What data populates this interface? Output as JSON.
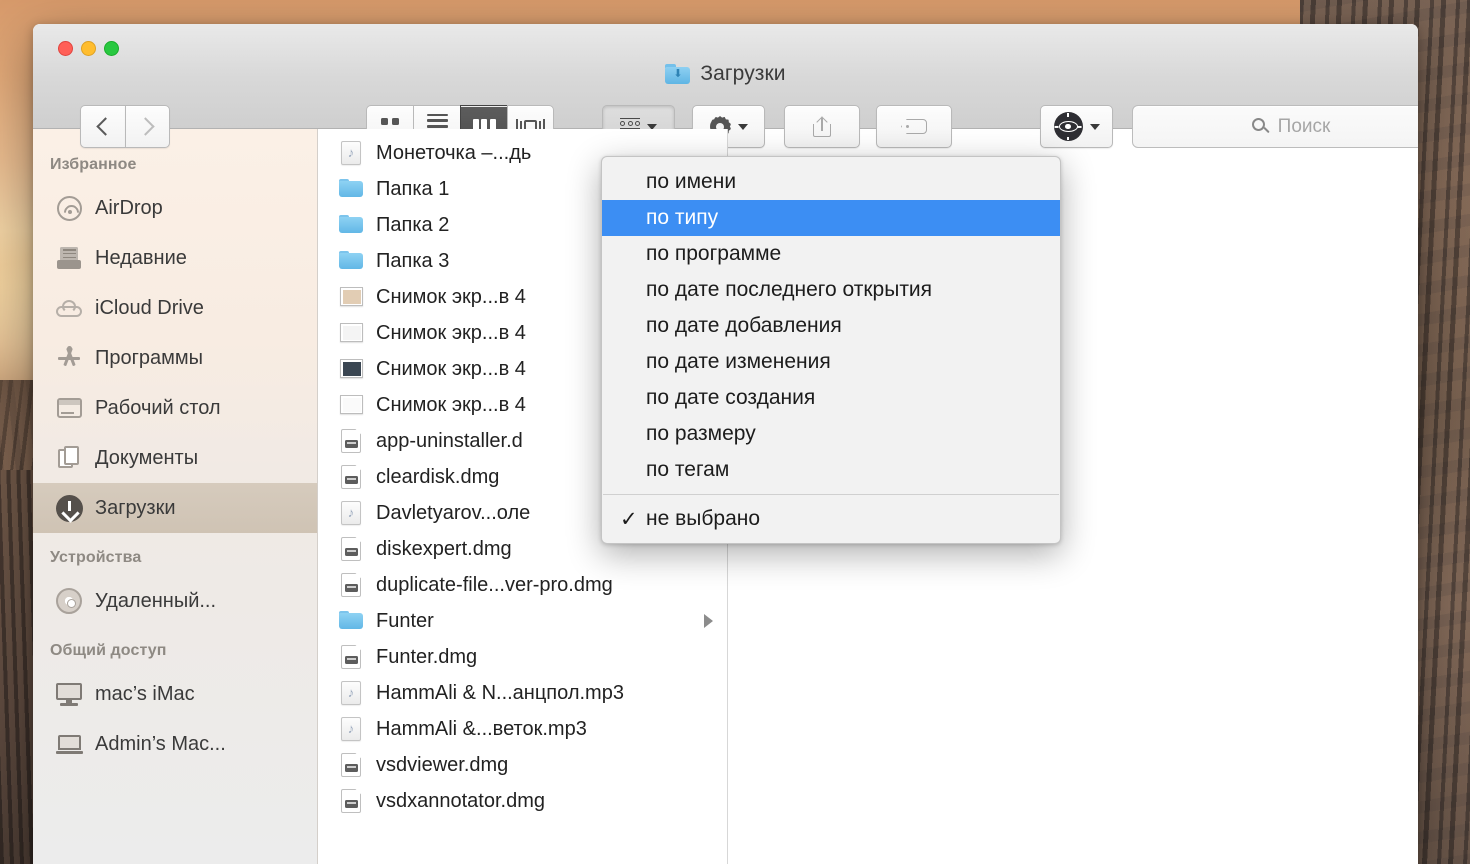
{
  "window": {
    "title": "Загрузки",
    "title_icon": "downloads-folder-icon",
    "traffic_lights": {
      "close": "#ff5f57",
      "minimize": "#ffbd2e",
      "zoom": "#28c840"
    }
  },
  "toolbar": {
    "back_icon": "chevron-left-icon",
    "forward_icon": "chevron-right-icon",
    "view_modes": [
      {
        "name": "icon-view",
        "icon": "grid-icon",
        "active": false
      },
      {
        "name": "list-view",
        "icon": "list-icon",
        "active": false
      },
      {
        "name": "column-view",
        "icon": "columns-icon",
        "active": true
      },
      {
        "name": "coverflow-view",
        "icon": "coverflow-icon",
        "active": false
      }
    ],
    "arrange_icon": "arrange-grid-icon",
    "gear_icon": "gear-icon",
    "share_icon": "share-icon",
    "tag_icon": "tag-icon",
    "eye_icon": "eye-app-icon",
    "caret_icon": "chevron-down-icon"
  },
  "search": {
    "placeholder": "Поиск",
    "value": "",
    "icon": "search-icon"
  },
  "sidebar": {
    "sections": [
      {
        "header": "Избранное",
        "items": [
          {
            "label": "AirDrop",
            "icon": "airdrop-icon",
            "selected": false
          },
          {
            "label": "Недавние",
            "icon": "recents-icon",
            "selected": false
          },
          {
            "label": "iCloud Drive",
            "icon": "cloud-icon",
            "selected": false
          },
          {
            "label": "Программы",
            "icon": "apps-icon",
            "selected": false
          },
          {
            "label": "Рабочий стол",
            "icon": "desktop-icon",
            "selected": false
          },
          {
            "label": "Документы",
            "icon": "documents-icon",
            "selected": false
          },
          {
            "label": "Загрузки",
            "icon": "downloads-icon",
            "selected": true
          }
        ]
      },
      {
        "header": "Устройства",
        "items": [
          {
            "label": "Удаленный...",
            "icon": "disc-icon",
            "selected": false
          }
        ]
      },
      {
        "header": "Общий доступ",
        "items": [
          {
            "label": "mac’s iMac",
            "icon": "imac-icon",
            "selected": false
          },
          {
            "label": "Admin’s Mac...",
            "icon": "laptop-icon",
            "selected": false
          }
        ]
      }
    ]
  },
  "file_list": [
    {
      "name": "Монеточка –...дь",
      "kind": "mp3",
      "disclosure": false
    },
    {
      "name": "Папка 1",
      "kind": "folder",
      "disclosure": false
    },
    {
      "name": "Папка 2",
      "kind": "folder",
      "disclosure": false
    },
    {
      "name": "Папка 3",
      "kind": "folder",
      "disclosure": false
    },
    {
      "name": "Снимок экр...в 4",
      "kind": "screenshot",
      "thumb": "#e2cdb4",
      "disclosure": false
    },
    {
      "name": "Снимок экр...в 4",
      "kind": "screenshot",
      "thumb": "#f4f4f4",
      "disclosure": false
    },
    {
      "name": "Снимок экр...в 4",
      "kind": "screenshot",
      "thumb": "#3a4652",
      "disclosure": false
    },
    {
      "name": "Снимок экр...в 4",
      "kind": "screenshot",
      "thumb": "#fafafa",
      "disclosure": false
    },
    {
      "name": "app-uninstaller.d",
      "kind": "dmg",
      "disclosure": false
    },
    {
      "name": "cleardisk.dmg",
      "kind": "dmg",
      "disclosure": false
    },
    {
      "name": "Davletyarov...оле",
      "kind": "mp3",
      "disclosure": false
    },
    {
      "name": "diskexpert.dmg",
      "kind": "dmg",
      "disclosure": false
    },
    {
      "name": "duplicate-file...ver-pro.dmg",
      "kind": "dmg",
      "disclosure": false
    },
    {
      "name": "Funter",
      "kind": "folder",
      "disclosure": true
    },
    {
      "name": "Funter.dmg",
      "kind": "dmg",
      "disclosure": false
    },
    {
      "name": "HammAli & N...анцпол.mp3",
      "kind": "mp3",
      "disclosure": false
    },
    {
      "name": "HammAli &...веток.mp3",
      "kind": "mp3",
      "disclosure": false
    },
    {
      "name": "vsdviewer.dmg",
      "kind": "dmg",
      "disclosure": false
    },
    {
      "name": "vsdxannotator.dmg",
      "kind": "dmg",
      "disclosure": false
    }
  ],
  "arrange_menu": {
    "items": [
      {
        "label": "по имени",
        "highlighted": false,
        "checked": false
      },
      {
        "label": "по типу",
        "highlighted": true,
        "checked": false
      },
      {
        "label": "по программе",
        "highlighted": false,
        "checked": false
      },
      {
        "label": "по дате последнего открытия",
        "highlighted": false,
        "checked": false
      },
      {
        "label": "по дате добавления",
        "highlighted": false,
        "checked": false
      },
      {
        "label": "по дате изменения",
        "highlighted": false,
        "checked": false
      },
      {
        "label": "по дате создания",
        "highlighted": false,
        "checked": false
      },
      {
        "label": "по размеру",
        "highlighted": false,
        "checked": false
      },
      {
        "label": "по тегам",
        "highlighted": false,
        "checked": false
      }
    ],
    "footer": {
      "label": "не выбрано",
      "checked": true,
      "check_glyph": "✓"
    },
    "highlight_color": "#3c8ef3"
  }
}
